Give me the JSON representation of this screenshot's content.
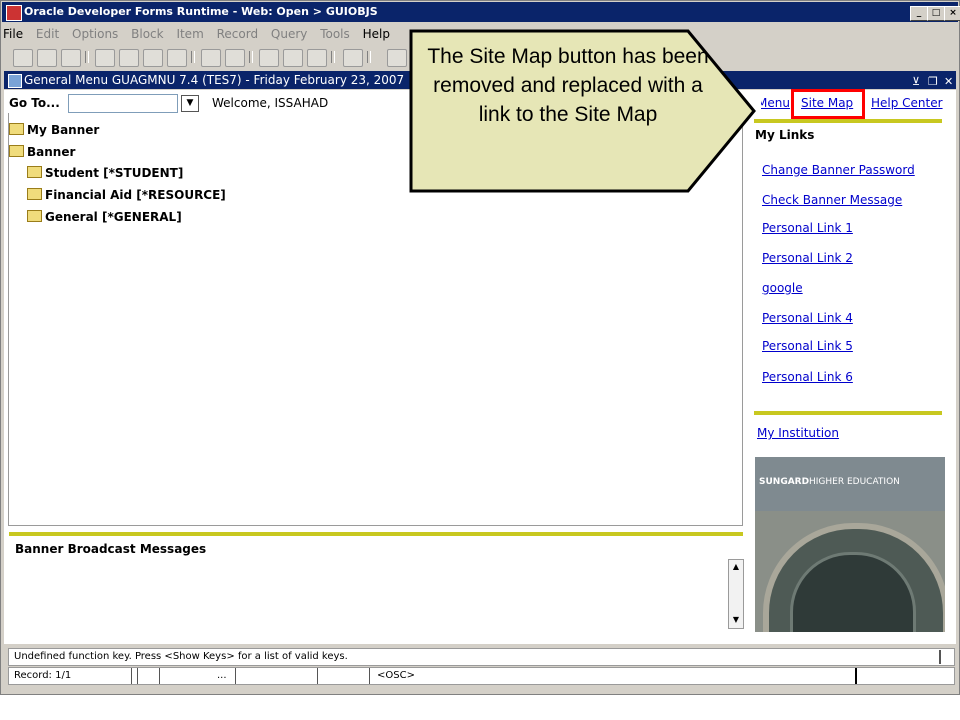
{
  "window": {
    "title": "Oracle Developer Forms Runtime - Web:  Open > GUIOBJS",
    "controls": [
      "_",
      "□",
      "×"
    ]
  },
  "menu": [
    "File",
    "Edit",
    "Options",
    "Block",
    "Item",
    "Record",
    "Query",
    "Tools",
    "Help"
  ],
  "form": {
    "title": "General Menu  GUAGMNU  7.4  (TES7) - Friday February 23, 2007",
    "goto_label": "Go To...",
    "goto_value": "",
    "welcome": "Welcome, ISSAHAD"
  },
  "tree": [
    {
      "label": "My Banner"
    },
    {
      "label": "Banner"
    },
    {
      "label": "Student [*STUDENT]"
    },
    {
      "label": "Financial Aid [*RESOURCE]"
    },
    {
      "label": "General [*GENERAL]"
    }
  ],
  "top_links": {
    "menu": "Menu",
    "site_map": "Site Map",
    "help_center": "Help Center",
    "separator": "|"
  },
  "my_links": {
    "heading": "My Links",
    "items": [
      "Change Banner Password",
      "Check Banner Message",
      "Personal Link 1",
      "Personal Link 2",
      "google",
      "Personal Link 4",
      "Personal Link 5",
      "Personal Link 6"
    ]
  },
  "my_institution": "My Institution",
  "banner_image": {
    "brand": "SUNGARD",
    "tagline": "HIGHER EDUCATION"
  },
  "broadcast": {
    "heading": "Banner Broadcast Messages"
  },
  "status": {
    "message": "Undefined function key. Press <Show Keys> for a list of valid keys.",
    "record": "Record: 1/1",
    "ellipsis": "...",
    "osc": "<OSC>"
  },
  "callout": {
    "text": "The Site Map button has been removed and replaced with a link to the Site Map"
  },
  "colors": {
    "title_bar": "#0a246a",
    "accent_bar": "#c8c820",
    "link": "#0000cc",
    "highlight": "#ff0000",
    "callout_fill": "#e6e6b6"
  }
}
